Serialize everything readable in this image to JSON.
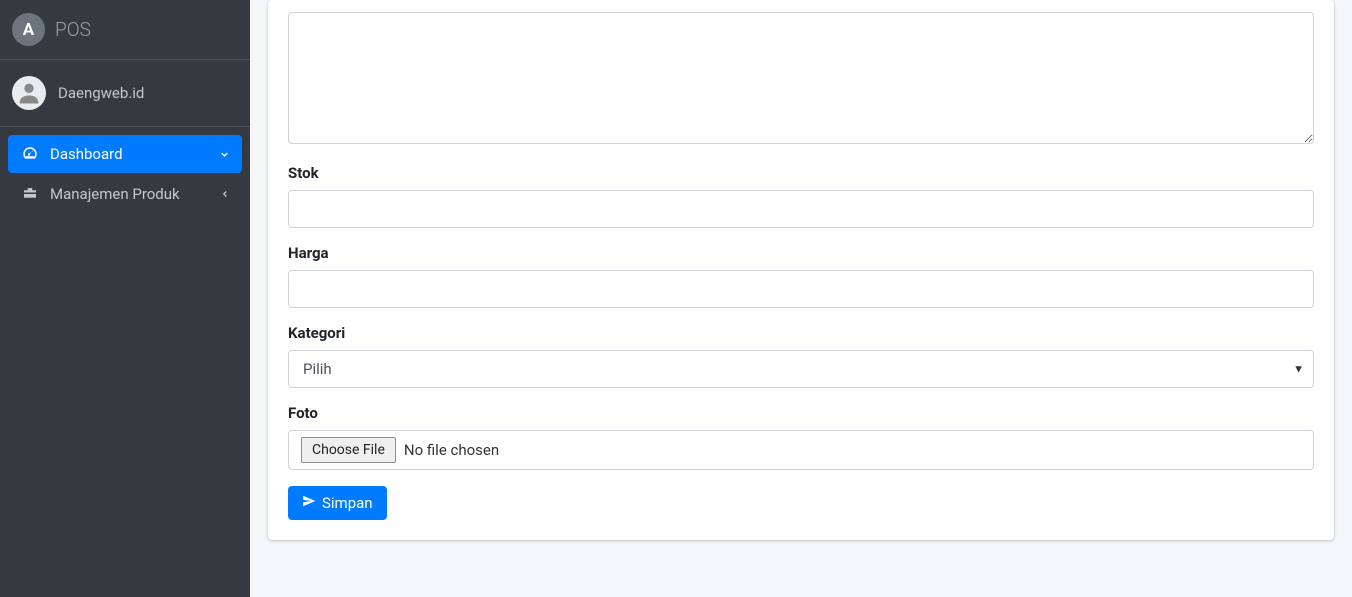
{
  "brand": {
    "text": "POS",
    "icon_letter": "A"
  },
  "user": {
    "name": "Daengweb.id"
  },
  "sidebar": {
    "items": [
      {
        "label": "Dashboard",
        "active": true
      },
      {
        "label": "Manajemen Produk",
        "active": false
      }
    ]
  },
  "form": {
    "stok_label": "Stok",
    "harga_label": "Harga",
    "kategori_label": "Kategori",
    "kategori_selected": "Pilih",
    "foto_label": "Foto",
    "file_button": "Choose File",
    "file_status": "No file chosen",
    "submit_label": "Simpan"
  }
}
